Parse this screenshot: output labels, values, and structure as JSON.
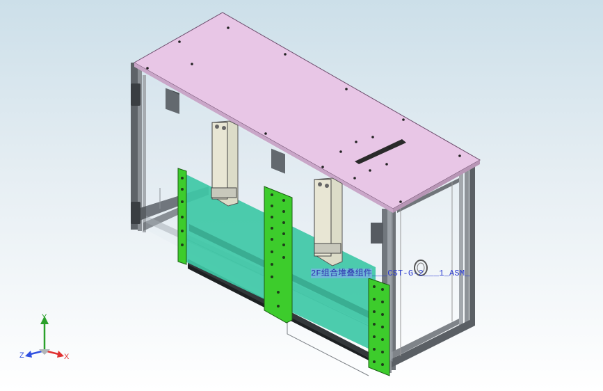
{
  "viewport": {
    "background_top": "#ccdfe9",
    "background_bottom": "#ffffff"
  },
  "model": {
    "top_plate_color": "#e8c6e6",
    "frame_color": "#6b7075",
    "guide_plate_color": "#3ec8a6",
    "bracket_color": "#3dcc2c",
    "cylinder_color": "#dcdcc8"
  },
  "annotation": {
    "highlighted": "2F组合堆叠组件",
    "suffix": "___CST-G-2___1_ASM_"
  },
  "triad": {
    "x_label": "X",
    "y_label": "Y",
    "z_label": "Z",
    "x_color": "#e03030",
    "y_color": "#2aa02a",
    "z_color": "#3050e0"
  }
}
